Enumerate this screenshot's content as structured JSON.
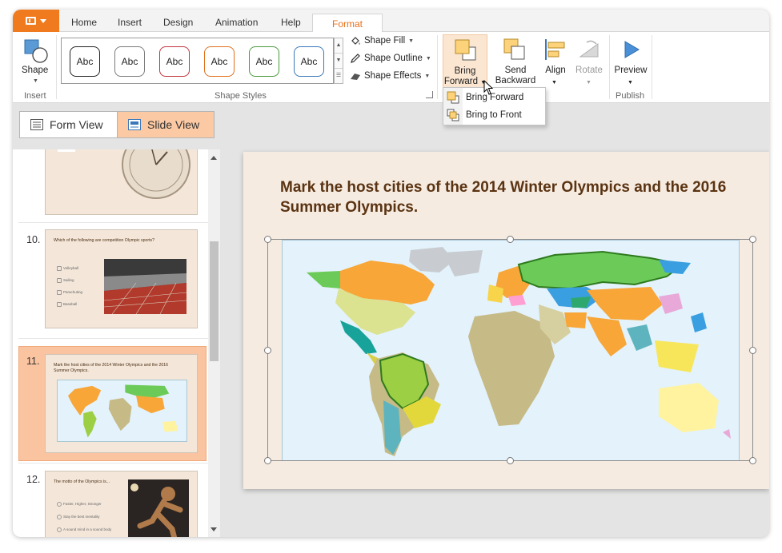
{
  "tabs": [
    "Home",
    "Insert",
    "Design",
    "Animation",
    "Help",
    "Format"
  ],
  "active_tab": "Format",
  "ribbon": {
    "shape_label": "Shape",
    "insert_group": "Insert",
    "shape_styles_group": "Shape Styles",
    "style_tiles": [
      {
        "label": "Abc",
        "border": "#222222"
      },
      {
        "label": "Abc",
        "border": "#6f6f6f"
      },
      {
        "label": "Abc",
        "border": "#c0343c"
      },
      {
        "label": "Abc",
        "border": "#e0701e"
      },
      {
        "label": "Abc",
        "border": "#4a9a3c"
      },
      {
        "label": "Abc",
        "border": "#3b78b8"
      }
    ],
    "shape_fill": "Shape Fill",
    "shape_outline": "Shape Outline",
    "shape_effects": "Shape Effects",
    "bring_forward_line1": "Bring",
    "bring_forward_line2": "Forward",
    "send_backward_line1": "Send",
    "send_backward_line2": "Backward",
    "align": "Align",
    "rotate": "Rotate",
    "preview": "Preview",
    "publish_group": "Publish"
  },
  "dropdown": {
    "items": [
      "Bring Forward",
      "Bring to Front"
    ]
  },
  "view_toggle": {
    "form_view": "Form View",
    "slide_view": "Slide View",
    "active": "Slide View"
  },
  "thumbnails": [
    {
      "number": "10.",
      "question": "Which of the following are competition Olympic sports?",
      "options": [
        "Volleyball",
        "Sailing",
        "Parachuting",
        "Baseball"
      ]
    },
    {
      "number": "11.",
      "question": "Mark the host cities of the 2014 Winter Olympics and the 2016 Summer Olympics."
    },
    {
      "number": "12.",
      "question": "The motto of the Olympics is...",
      "options": [
        "Faster, Higher, Stronger",
        "Stay the best mentality",
        "A sound mind in a sound body"
      ]
    }
  ],
  "slide": {
    "title": "Mark the host cities of the 2014 Winter Olympics and the 2016 Summer Olympics."
  },
  "colors": {
    "accent": "#f07a1e",
    "selected_thumb": "#fbc4a0",
    "slide_bg": "#f6ebe1",
    "title": "#5a3312"
  }
}
